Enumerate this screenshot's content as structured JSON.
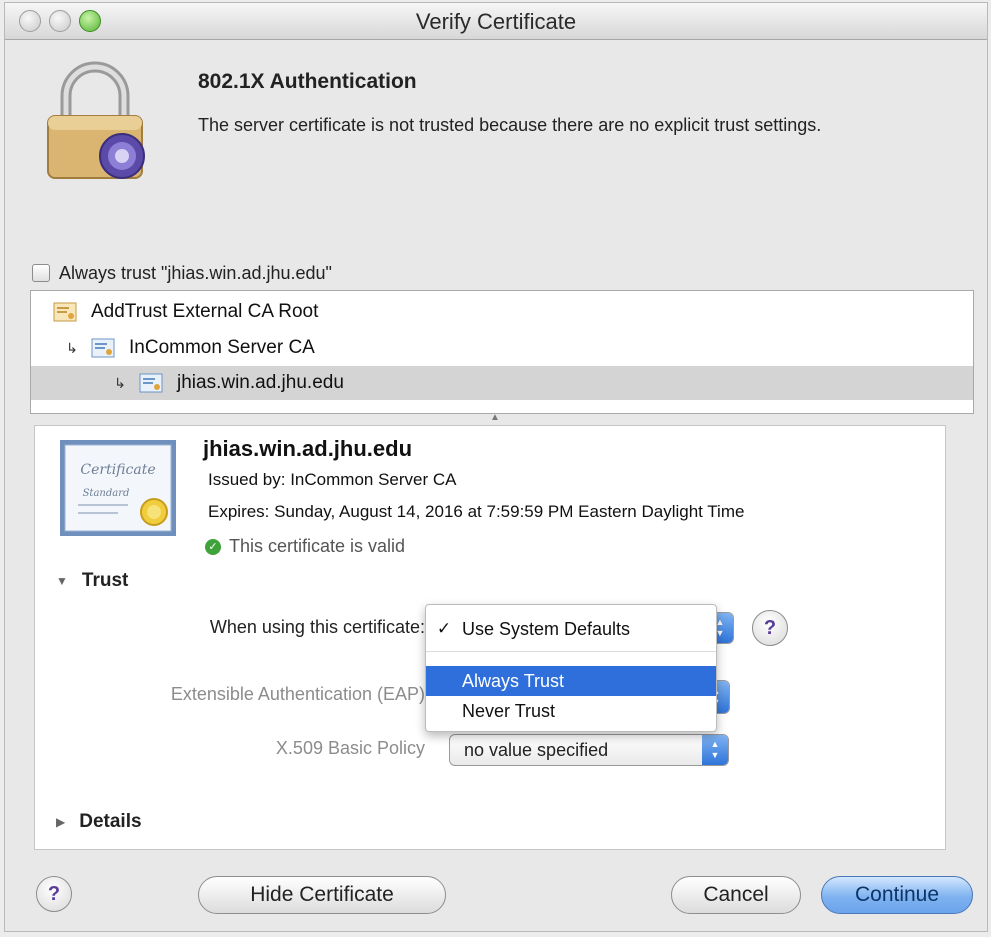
{
  "window": {
    "title": "Verify Certificate"
  },
  "header": {
    "title": "802.1X Authentication",
    "message": "The server certificate is not trusted because there are no explicit trust settings."
  },
  "always_trust": {
    "label": "Always trust \"jhias.win.ad.jhu.edu\"",
    "checked": false
  },
  "chain": [
    {
      "label": "AddTrust External CA Root",
      "level": 0,
      "selected": false
    },
    {
      "label": "InCommon Server CA",
      "level": 1,
      "selected": false
    },
    {
      "label": "jhias.win.ad.jhu.edu",
      "level": 2,
      "selected": true
    }
  ],
  "certificate": {
    "name": "jhias.win.ad.jhu.edu",
    "issued_by": "Issued by: InCommon Server CA",
    "expires": "Expires: Sunday, August 14, 2016 at 7:59:59 PM Eastern Daylight Time",
    "status": "This certificate is valid",
    "thumb_text_1": "Certificate",
    "thumb_text_2": "Standard"
  },
  "trust": {
    "title": "Trust",
    "when_using_label": "When using this certificate:",
    "eap_label": "Extensible Authentication (EAP)",
    "x509_label": "X.509 Basic Policy",
    "x509_value": "no value specified",
    "menu": {
      "items": [
        {
          "label": "Use System Defaults",
          "checked": true,
          "highlighted": false
        },
        {
          "label": "Always Trust",
          "checked": false,
          "highlighted": true
        },
        {
          "label": "Never Trust",
          "checked": false,
          "highlighted": false
        }
      ],
      "check_glyph": "✓"
    }
  },
  "details": {
    "title": "Details"
  },
  "buttons": {
    "help": "?",
    "hide_certificate": "Hide Certificate",
    "cancel": "Cancel",
    "continue": "Continue"
  },
  "colors": {
    "accent": "#2f6fdb",
    "valid": "#3ea33a"
  }
}
